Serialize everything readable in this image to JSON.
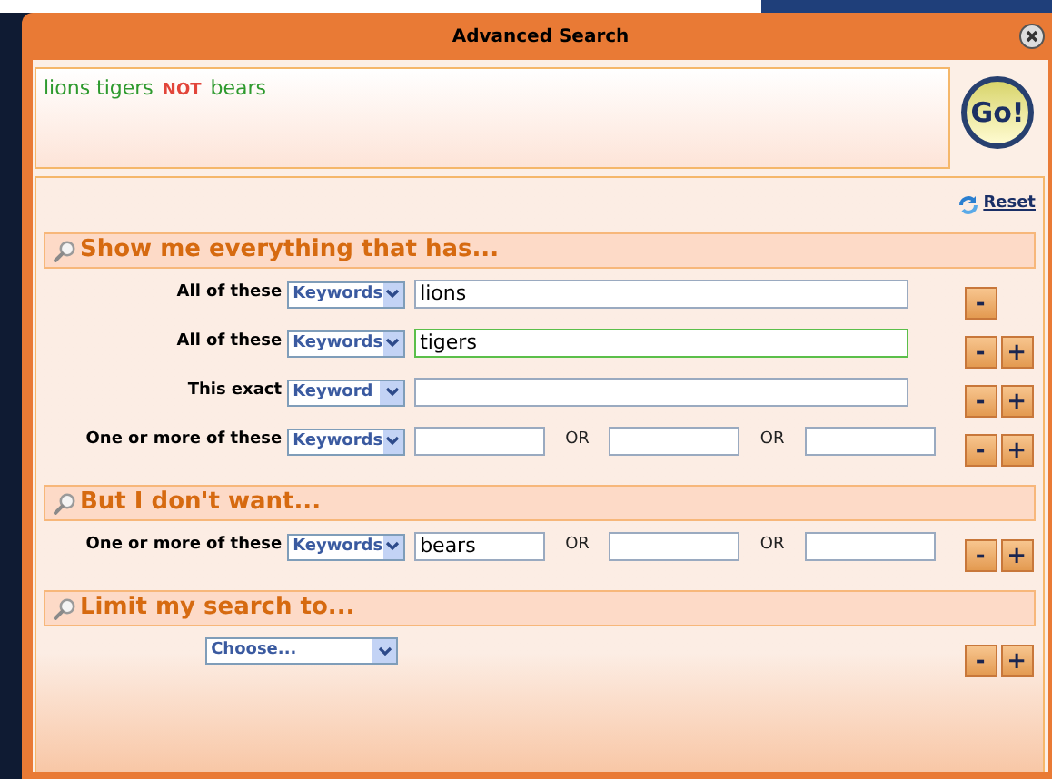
{
  "window": {
    "title": "Advanced Search"
  },
  "query": [
    {
      "text": "lions tigers",
      "kind": "term"
    },
    {
      "text": "NOT",
      "kind": "operator"
    },
    {
      "text": "bears",
      "kind": "term"
    }
  ],
  "go_button": {
    "label": "Go!"
  },
  "reset_link": {
    "label": "Reset"
  },
  "sections": [
    {
      "title": "Show me everything that has...",
      "rows": [
        {
          "kind": "single",
          "label": "All of these",
          "field_type": "Keywords",
          "fields": [
            {
              "value": "lions",
              "focused": false
            }
          ],
          "can_add": false
        },
        {
          "kind": "single",
          "label": "All of these",
          "field_type": "Keywords",
          "fields": [
            {
              "value": "tigers",
              "focused": true
            }
          ],
          "can_add": true
        },
        {
          "kind": "single",
          "label": "This exact",
          "field_type": "Keyword",
          "fields": [
            {
              "focused": false
            }
          ],
          "can_add": true
        },
        {
          "kind": "multi",
          "label": "One or more of these",
          "field_type": "Keywords",
          "fields": [
            {
              "focused": false
            },
            {
              "separator": "OR",
              "focused": false
            },
            {
              "separator": "OR",
              "focused": false
            }
          ],
          "can_add": true
        }
      ]
    },
    {
      "title": "But I don't want...",
      "rows": [
        {
          "kind": "multi",
          "label": "One or more of these",
          "field_type": "Keywords",
          "fields": [
            {
              "value": "bears",
              "focused": false
            },
            {
              "separator": "OR",
              "focused": false
            },
            {
              "separator": "OR",
              "focused": false
            }
          ],
          "can_add": true
        }
      ]
    },
    {
      "title": "Limit my search to...",
      "rows": [
        {
          "kind": "choose",
          "field_type": "Choose...",
          "can_add": true
        }
      ]
    }
  ],
  "row_buttons": {
    "remove": "-",
    "add": "+"
  }
}
